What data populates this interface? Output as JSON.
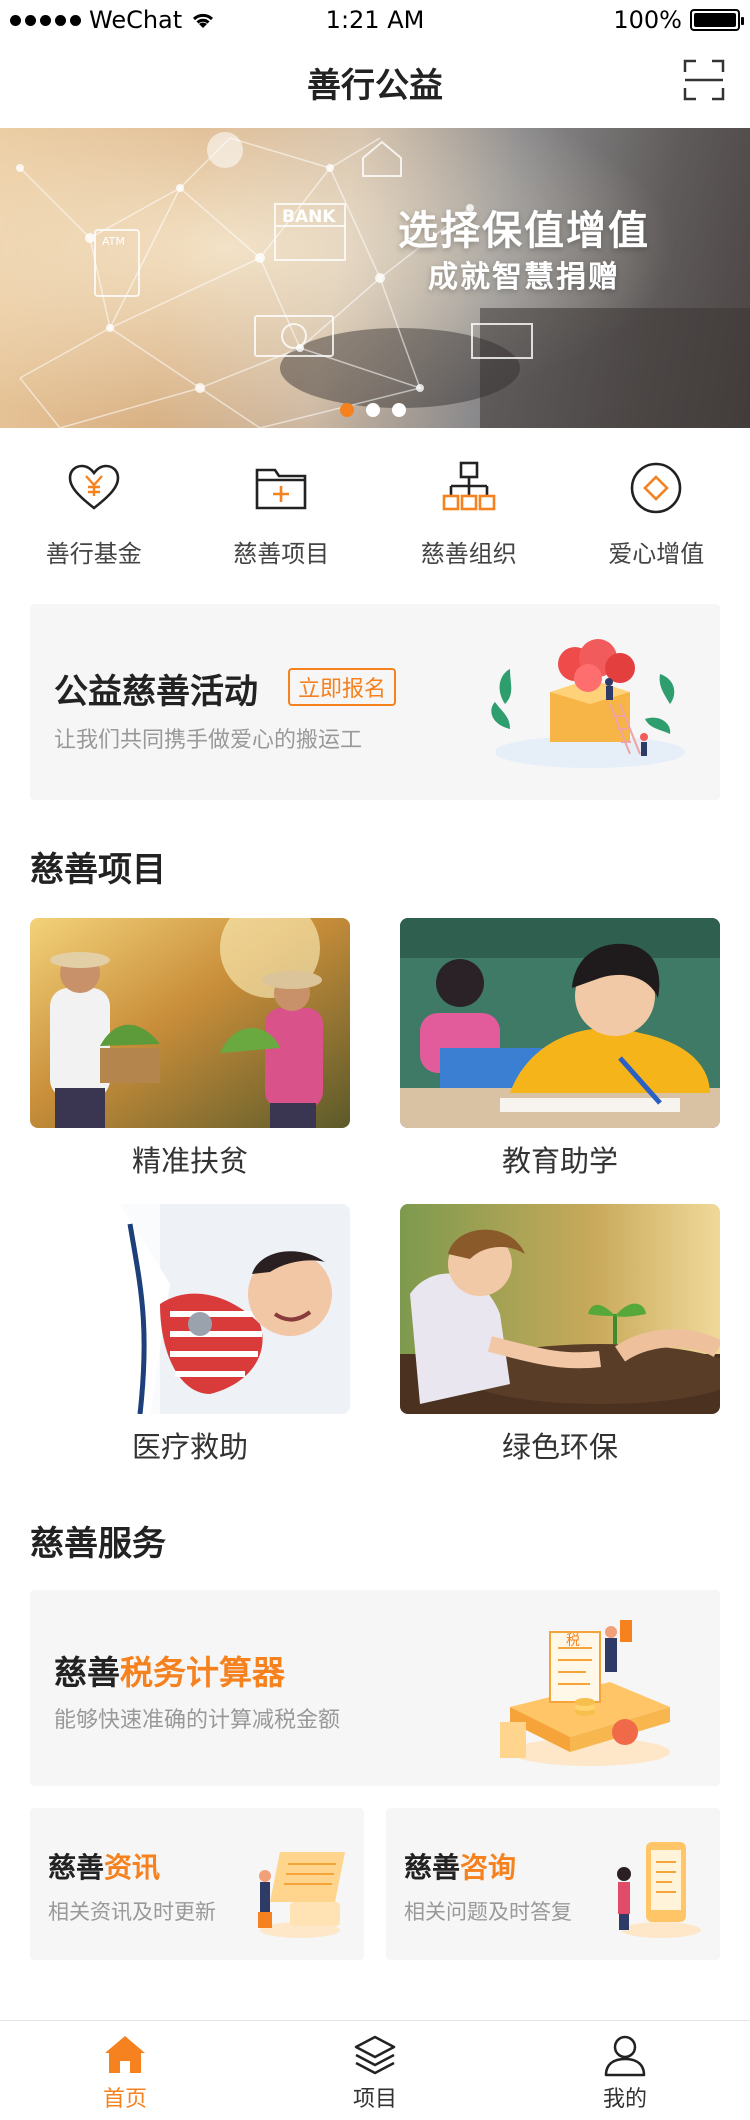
{
  "status_bar": {
    "carrier": "WeChat",
    "time": "1:21 AM",
    "battery": "100%",
    "battery_level": 1.0
  },
  "nav": {
    "title": "善行公益",
    "right_icon": "scan-icon"
  },
  "banner": {
    "title": "选择保值增值",
    "subtitle": "成就智慧捐赠",
    "sign_texts": [
      "BANK",
      "ATM"
    ],
    "slide_count": 3,
    "active_slide": 1
  },
  "quick_nav": [
    {
      "label": "善行基金",
      "icon": "heart-yen-icon"
    },
    {
      "label": "慈善项目",
      "icon": "folder-plus-icon"
    },
    {
      "label": "慈善组织",
      "icon": "org-chart-icon"
    },
    {
      "label": "爱心增值",
      "icon": "diamond-coin-icon"
    }
  ],
  "promo": {
    "title": "公益慈善活动",
    "badge": "立即报名",
    "desc": "让我们共同携手做爱心的搬运工"
  },
  "projects": {
    "title": "慈善项目",
    "items": [
      {
        "label": "精准扶贫"
      },
      {
        "label": "教育助学"
      },
      {
        "label": "医疗救助"
      },
      {
        "label": "绿色环保"
      }
    ]
  },
  "services": {
    "title": "慈善服务",
    "calculator": {
      "prefix": "慈善",
      "highlight": "税务计算器",
      "desc": "能够快速准确的计算减税金额",
      "art_text": "税"
    },
    "news": {
      "prefix": "慈善",
      "highlight": "资讯",
      "desc": "相关资讯及时更新"
    },
    "consult": {
      "prefix": "慈善",
      "highlight": "咨询",
      "desc": "相关问题及时答复"
    }
  },
  "tab_bar": [
    {
      "label": "首页",
      "icon": "home-icon",
      "active": true
    },
    {
      "label": "项目",
      "icon": "layers-icon",
      "active": false
    },
    {
      "label": "我的",
      "icon": "user-icon",
      "active": false
    }
  ],
  "colors": {
    "accent": "#f5821f",
    "text": "#222222",
    "subtext": "#999999",
    "card_bg": "#f6f6f6"
  }
}
